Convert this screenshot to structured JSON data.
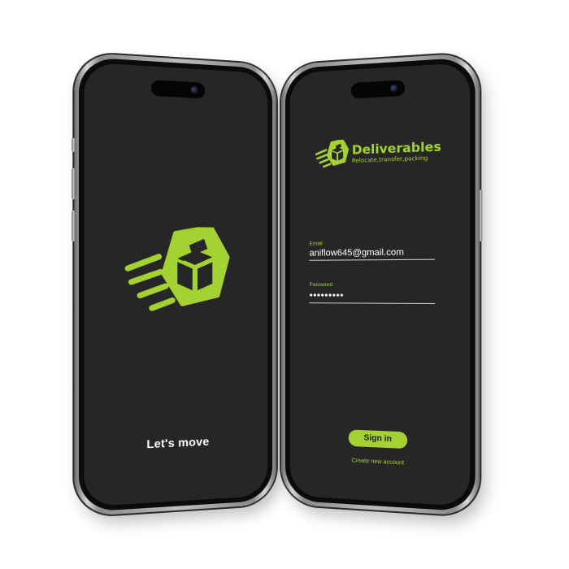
{
  "colors": {
    "accent": "#a4d233",
    "screen_bg": "#262626",
    "text": "#ffffff"
  },
  "splash": {
    "logo_icon": "box-delivery-logo",
    "tagline": "Let's move"
  },
  "login": {
    "brand": {
      "logo_icon": "box-delivery-logo",
      "name": "Deliverables",
      "subtitle": "Relocate,transfer,packing"
    },
    "email": {
      "label": "Email",
      "value": "aniflow645@gmail.com"
    },
    "password": {
      "label": "Password",
      "value": "•••••••••"
    },
    "sign_in_label": "Sign in",
    "create_account_label": "Create new account"
  }
}
